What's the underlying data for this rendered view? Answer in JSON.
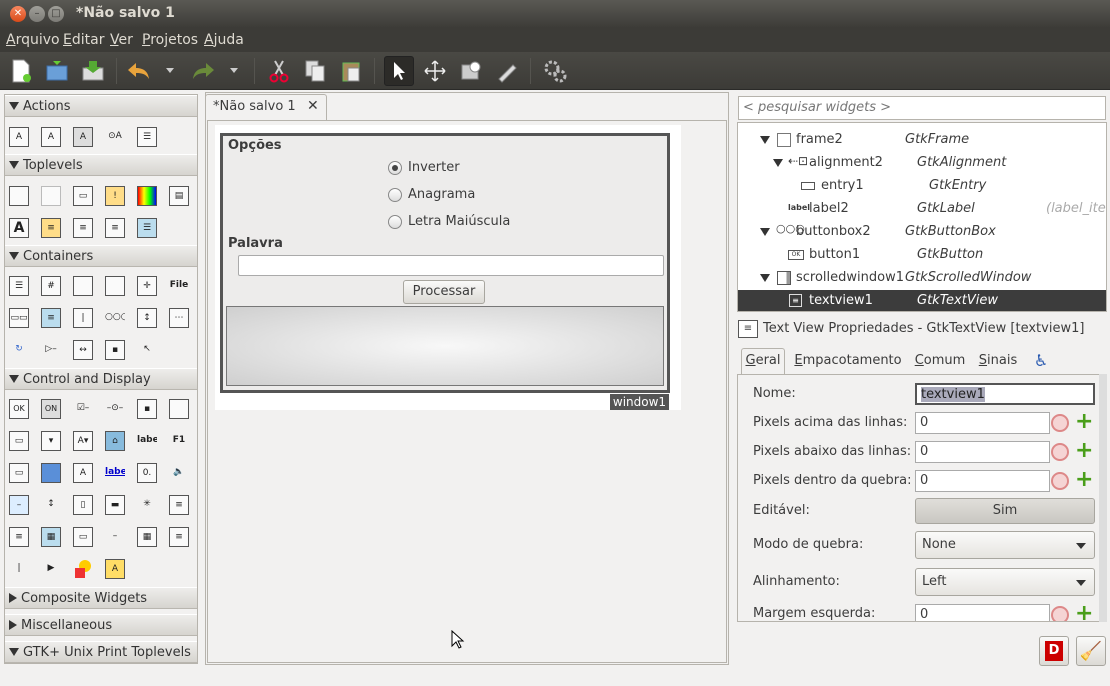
{
  "window": {
    "title": "*Não salvo 1"
  },
  "menu": [
    {
      "first": "A",
      "rest": "rquivo"
    },
    {
      "first": "E",
      "rest": "ditar"
    },
    {
      "first": "V",
      "rest": "er"
    },
    {
      "first": "P",
      "rest": "rojetos"
    },
    {
      "first": "A",
      "rest": "juda"
    }
  ],
  "palette": {
    "groups_open": [
      "Actions",
      "Toplevels",
      "Containers",
      "Control and Display"
    ],
    "groups_closed": [
      "Composite Widgets",
      "Miscellaneous",
      "GTK+ Unix Print Toplevels"
    ],
    "icon_texts": {
      "file": "File",
      "ok": "OK",
      "on": "ON",
      "label": "label",
      "f1": "F1",
      "label_blue": "label",
      "a": "A"
    }
  },
  "document": {
    "tab_label": "*Não salvo 1",
    "window_label": "window1",
    "frame_title": "Opções",
    "radios": [
      {
        "label": "Inverter",
        "selected": true
      },
      {
        "label": "Anagrama",
        "selected": false
      },
      {
        "label": "Letra Maiúscula",
        "selected": false
      }
    ],
    "word_label": "Palavra",
    "button_label": "Processar"
  },
  "inspector": {
    "search_placeholder": "< pesquisar widgets >",
    "rows": [
      {
        "name": "frame2",
        "type": "GtkFrame",
        "extra": ""
      },
      {
        "name": "alignment2",
        "type": "GtkAlignment",
        "extra": ""
      },
      {
        "name": "entry1",
        "type": "GtkEntry",
        "extra": ""
      },
      {
        "name": "label2",
        "type": "GtkLabel",
        "extra": "(label_iter"
      },
      {
        "name": "buttonbox2",
        "type": "GtkButtonBox",
        "extra": ""
      },
      {
        "name": "button1",
        "type": "GtkButton",
        "extra": ""
      },
      {
        "name": "scrolledwindow1",
        "type": "GtkScrolledWindow",
        "extra": ""
      },
      {
        "name": "textview1",
        "type": "GtkTextView",
        "extra": ""
      }
    ],
    "icon_texts": {
      "label": "label",
      "ok": "OK"
    }
  },
  "properties": {
    "header": "Text View Propriedades - GtkTextView [textview1]",
    "tabs": [
      {
        "first": "G",
        "rest": "eral"
      },
      {
        "first": "E",
        "rest": "mpacotamento"
      },
      {
        "first": "C",
        "rest": "omum"
      },
      {
        "first": "S",
        "rest": "inais"
      }
    ],
    "fields": {
      "name_label": "Nome:",
      "name_value": "textview1",
      "above_label": "Pixels acima das linhas:",
      "above_value": "0",
      "below_label": "Pixels abaixo das linhas:",
      "below_value": "0",
      "inside_label": "Pixels dentro da quebra:",
      "inside_value": "0",
      "editable_label": "Editável:",
      "editable_value": "Sim",
      "wrap_label": "Modo de quebra:",
      "wrap_value": "None",
      "justify_label": "Alinhamento:",
      "justify_value": "Left",
      "leftmargin_label": "Margem esquerda:",
      "leftmargin_value": "0"
    }
  },
  "colors": {
    "selected_row": "#3c3c3c",
    "accent": "#dd4814"
  }
}
